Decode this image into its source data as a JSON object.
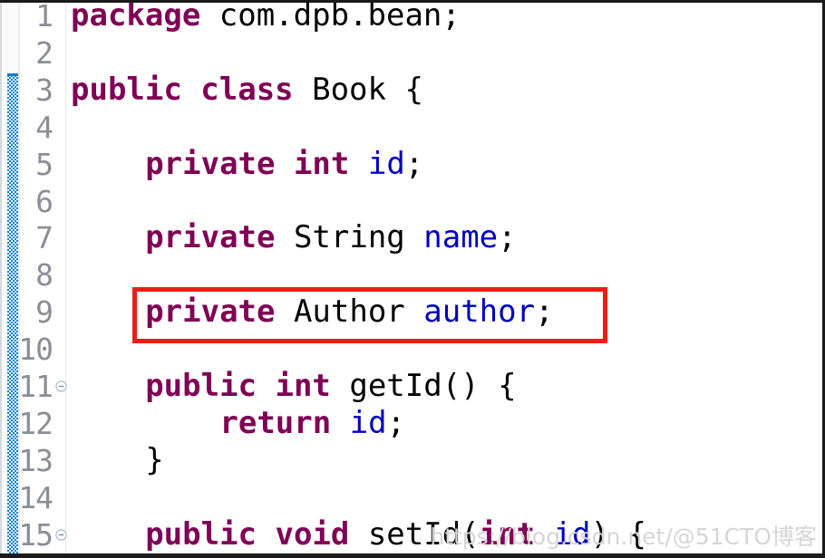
{
  "editor": {
    "language": "java",
    "font_family_kind": "monospace-serif",
    "colors": {
      "background": "#ffffff",
      "keyword": "#7f0055",
      "field_identifier": "#0000c0",
      "plain_text": "#000000",
      "line_number": "#8a8f96",
      "change_bar": "#0a82d0",
      "annotation_box": "#ee1c15",
      "watermark": "#d6d6d6",
      "gutter_separator": "#e7e7ea"
    },
    "change_bar": {
      "name": "change-bar",
      "starts_at_line": 3,
      "tooltip": ""
    },
    "lines": [
      {
        "number": "1",
        "fold_marker": "",
        "indent": 0,
        "tokens": [
          {
            "t": "package",
            "k": "kw"
          },
          {
            "t": " com.dpb.bean;",
            "k": "plain"
          }
        ]
      },
      {
        "number": "2",
        "fold_marker": "",
        "indent": 0,
        "tokens": []
      },
      {
        "number": "3",
        "fold_marker": "",
        "indent": 0,
        "tokens": [
          {
            "t": "public class",
            "k": "kw"
          },
          {
            "t": " Book {",
            "k": "plain"
          }
        ]
      },
      {
        "number": "4",
        "fold_marker": "",
        "indent": 0,
        "tokens": []
      },
      {
        "number": "5",
        "fold_marker": "",
        "indent": 4,
        "tokens": [
          {
            "t": "private int",
            "k": "kw"
          },
          {
            "t": " ",
            "k": "plain"
          },
          {
            "t": "id",
            "k": "fld"
          },
          {
            "t": ";",
            "k": "plain"
          }
        ]
      },
      {
        "number": "6",
        "fold_marker": "",
        "indent": 0,
        "tokens": []
      },
      {
        "number": "7",
        "fold_marker": "",
        "indent": 4,
        "tokens": [
          {
            "t": "private",
            "k": "kw"
          },
          {
            "t": " String ",
            "k": "plain"
          },
          {
            "t": "name",
            "k": "fld"
          },
          {
            "t": ";",
            "k": "plain"
          }
        ]
      },
      {
        "number": "8",
        "fold_marker": "",
        "indent": 0,
        "tokens": []
      },
      {
        "number": "9",
        "fold_marker": "",
        "indent": 4,
        "highlighted": true,
        "tokens": [
          {
            "t": "private",
            "k": "kw"
          },
          {
            "t": " Author ",
            "k": "plain"
          },
          {
            "t": "author",
            "k": "fld"
          },
          {
            "t": ";",
            "k": "plain"
          }
        ]
      },
      {
        "number": "10",
        "fold_marker": "",
        "indent": 0,
        "tokens": []
      },
      {
        "number": "11",
        "fold_marker": "collapse-fold-icon",
        "indent": 4,
        "tokens": [
          {
            "t": "public int",
            "k": "kw"
          },
          {
            "t": " getId() {",
            "k": "plain"
          }
        ]
      },
      {
        "number": "12",
        "fold_marker": "",
        "indent": 8,
        "tokens": [
          {
            "t": "return",
            "k": "kw"
          },
          {
            "t": " ",
            "k": "plain"
          },
          {
            "t": "id",
            "k": "fld"
          },
          {
            "t": ";",
            "k": "plain"
          }
        ]
      },
      {
        "number": "13",
        "fold_marker": "",
        "indent": 4,
        "tokens": [
          {
            "t": "}",
            "k": "plain"
          }
        ]
      },
      {
        "number": "14",
        "fold_marker": "",
        "indent": 0,
        "tokens": []
      },
      {
        "number": "15",
        "fold_marker": "collapse-fold-icon",
        "indent": 4,
        "tokens": [
          {
            "t": "public void",
            "k": "kw"
          },
          {
            "t": " setId(",
            "k": "plain"
          },
          {
            "t": "int",
            "k": "kw"
          },
          {
            "t": " ",
            "k": "plain"
          },
          {
            "t": "id",
            "k": "fld"
          },
          {
            "t": ") {",
            "k": "plain"
          }
        ]
      }
    ]
  },
  "annotation": {
    "box_label": "red-highlight-rectangle",
    "targets_line": "9"
  },
  "watermark": {
    "text": "https://blog.csdn.net/@51CTO博客"
  }
}
